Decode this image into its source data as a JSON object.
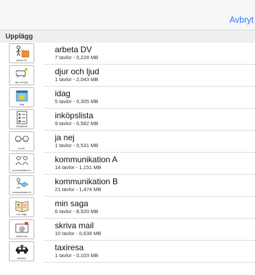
{
  "navbar": {
    "cancel_label": "Avbryt"
  },
  "section": {
    "title": "Upplägg"
  },
  "items": [
    {
      "icon": "folder-person-icon",
      "caption": "arbeta DV",
      "name": "arbeta DV",
      "meta": "7 tavlor - 0,228 MB"
    },
    {
      "icon": "cow-bird-icon",
      "caption": "djur och ljud",
      "name": "djur och ljud",
      "meta": "1 tavlor - 2,043 MB"
    },
    {
      "icon": "calendar-sun-icon",
      "caption": "idag",
      "name": "idag",
      "meta": "5 tavlor - 0,305 MB"
    },
    {
      "icon": "shopping-list-icon",
      "caption": "inköpslista",
      "name": "inköpslista",
      "meta": "9 tavlor - 0,582 MB"
    },
    {
      "icon": "yes-no-faces-icon",
      "caption": "ja nej",
      "name": "ja nej",
      "meta": "1 tavlor - 0,531 MB"
    },
    {
      "icon": "conversation-icon",
      "caption": "kommunikation A",
      "name": "kommunikation A",
      "meta": "14 tavlor - 1,151 MB"
    },
    {
      "icon": "communication-book-icon",
      "caption": "kommunikation B",
      "name": "kommunikation B",
      "meta": "21 tavlor - 1,474 MB"
    },
    {
      "icon": "storybook-icon",
      "caption": "min saga",
      "name": "min saga",
      "meta": "6 tavlor - 8,520 MB"
    },
    {
      "icon": "email-icon",
      "caption": "skriva mail",
      "name": "skriva mail",
      "meta": "10 tavlor - 0,639 MB"
    },
    {
      "icon": "taxi-icon",
      "caption": "taxiresa",
      "name": "taxiresa",
      "meta": "1 tavlor - 0,103 MB"
    }
  ]
}
